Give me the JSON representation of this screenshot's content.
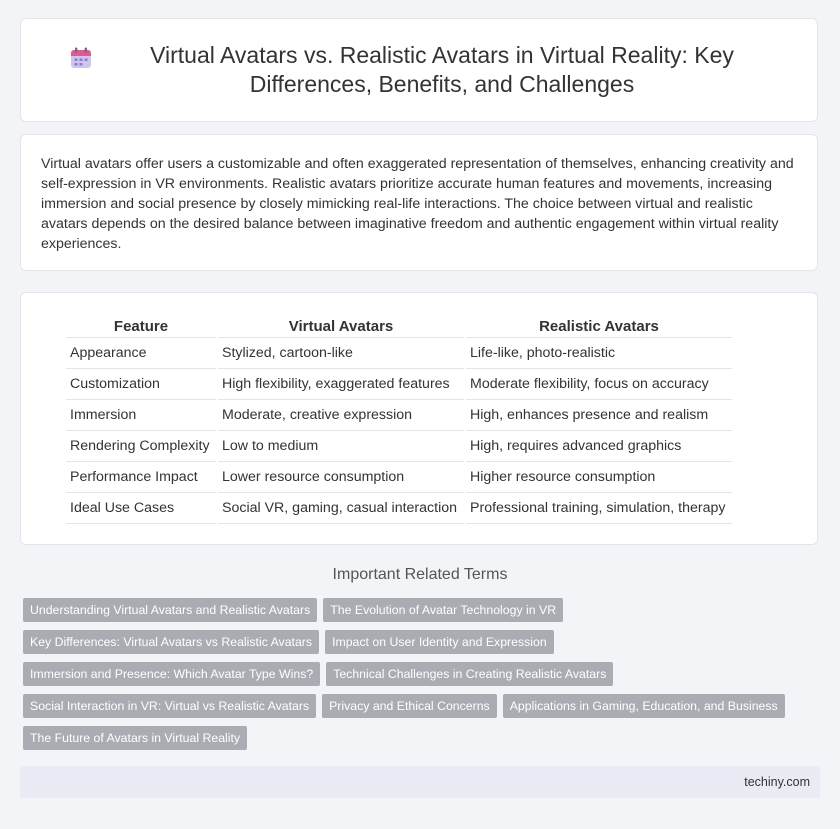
{
  "page": {
    "title": "Virtual Avatars vs. Realistic Avatars in Virtual Reality: Key Differences, Benefits, and Challenges",
    "icon": "calendar-icon"
  },
  "intro": "Virtual avatars offer users a customizable and often exaggerated representation of themselves, enhancing creativity and self-expression in VR environments. Realistic avatars prioritize accurate human features and movements, increasing immersion and social presence by closely mimicking real-life interactions. The choice between virtual and realistic avatars depends on the desired balance between imaginative freedom and authentic engagement within virtual reality experiences.",
  "table": {
    "headers": [
      "Feature",
      "Virtual Avatars",
      "Realistic Avatars"
    ],
    "rows": [
      [
        "Appearance",
        "Stylized, cartoon-like",
        "Life-like, photo-realistic"
      ],
      [
        "Customization",
        "High flexibility, exaggerated features",
        "Moderate flexibility, focus on accuracy"
      ],
      [
        "Immersion",
        "Moderate, creative expression",
        "High, enhances presence and realism"
      ],
      [
        "Rendering Complexity",
        "Low to medium",
        "High, requires advanced graphics"
      ],
      [
        "Performance Impact",
        "Lower resource consumption",
        "Higher resource consumption"
      ],
      [
        "Ideal Use Cases",
        "Social VR, gaming, casual interaction",
        "Professional training, simulation, therapy"
      ]
    ]
  },
  "related": {
    "heading": "Important Related Terms",
    "tags": [
      "Understanding Virtual Avatars and Realistic Avatars",
      "The Evolution of Avatar Technology in VR",
      "Key Differences: Virtual Avatars vs Realistic Avatars",
      "Impact on User Identity and Expression",
      "Immersion and Presence: Which Avatar Type Wins?",
      "Technical Challenges in Creating Realistic Avatars",
      "Social Interaction in VR: Virtual vs Realistic Avatars",
      "Privacy and Ethical Concerns",
      "Applications in Gaming, Education, and Business",
      "The Future of Avatars in Virtual Reality"
    ]
  },
  "footer": {
    "site": "techiny.com"
  },
  "colors": {
    "tag_bg": "#a9acb2",
    "footer_bg": "#e9ecf5",
    "page_bg": "#f3f4f7"
  }
}
